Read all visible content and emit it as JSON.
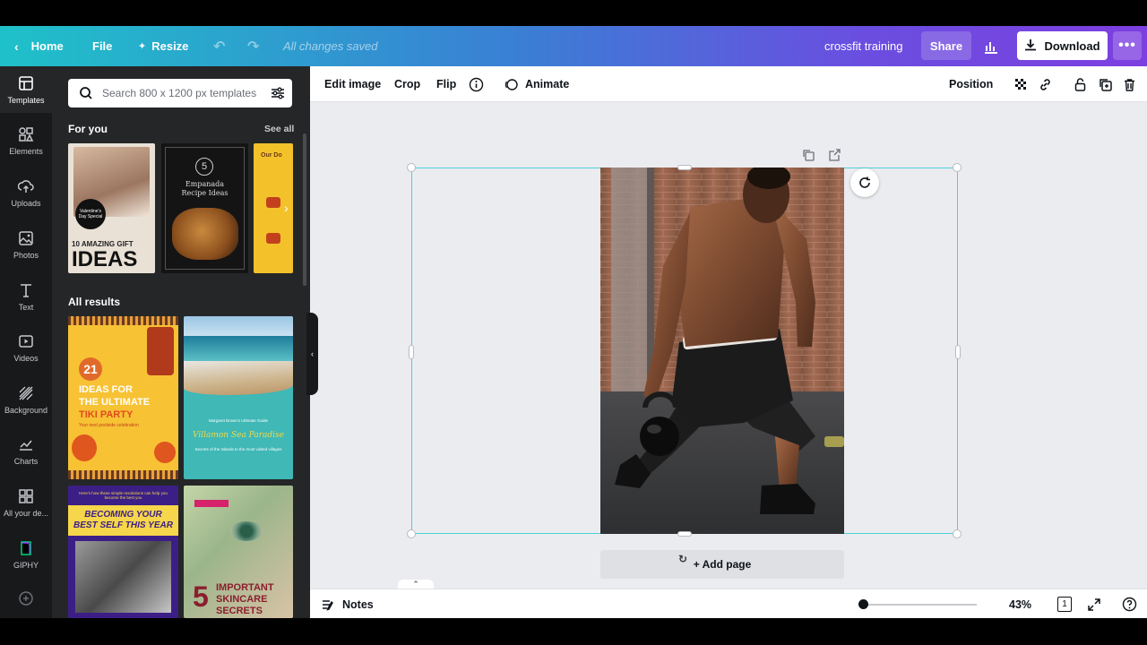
{
  "topbar": {
    "home_label": "Home",
    "file_label": "File",
    "resize_label": "Resize",
    "save_status": "All changes saved",
    "doc_title": "crossfit training",
    "share_label": "Share",
    "download_label": "Download",
    "more_label": "•••"
  },
  "rail": {
    "items": [
      {
        "label": "Templates",
        "icon": "templates-icon"
      },
      {
        "label": "Elements",
        "icon": "elements-icon"
      },
      {
        "label": "Uploads",
        "icon": "uploads-icon"
      },
      {
        "label": "Photos",
        "icon": "photos-icon"
      },
      {
        "label": "Text",
        "icon": "text-icon"
      },
      {
        "label": "Videos",
        "icon": "videos-icon"
      },
      {
        "label": "Background",
        "icon": "background-icon"
      },
      {
        "label": "Charts",
        "icon": "charts-icon"
      },
      {
        "label": "All your de...",
        "icon": "folder-icon"
      },
      {
        "label": "GIPHY",
        "icon": "giphy-icon"
      },
      {
        "label": "",
        "icon": "more-apps-icon"
      }
    ]
  },
  "panel": {
    "search_placeholder": "Search 800 x 1200 px templates",
    "for_you_title": "For you",
    "see_all_label": "See all",
    "all_results_title": "All results",
    "for_you_thumbs": [
      {
        "line1": "10 AMAZING GIFT",
        "line2": "IDEAS",
        "badge": "Valentine's Day Special"
      },
      {
        "number": "5",
        "line1": "Empanada",
        "line2": "Recipe Ideas"
      },
      {
        "line1": "Our Do"
      }
    ],
    "result_thumbs": [
      {
        "number": "21",
        "line1": "IDEAS FOR",
        "line2": "THE ULTIMATE",
        "line3": "TIKI PARTY",
        "line4": "Your next poolside celebration"
      },
      {
        "line1": "Margaret Brown's Ultimate Guide",
        "line2": "Villamon Sea Paradise",
        "line3": "Secrets of the Islands to the most visited villages"
      },
      {
        "line0": "Here's how these simple resolutions can help you become the best you",
        "line1": "BECOMING YOUR",
        "line2": "BEST SELF THIS YEAR"
      },
      {
        "number": "5",
        "line1": "IMPORTANT",
        "line2": "SKINCARE",
        "line3": "SECRETS"
      }
    ]
  },
  "toolbar": {
    "edit_image_label": "Edit image",
    "crop_label": "Crop",
    "flip_label": "Flip",
    "animate_label": "Animate",
    "position_label": "Position"
  },
  "canvas": {
    "add_page_label": "+ Add page"
  },
  "bottombar": {
    "notes_label": "Notes",
    "zoom_value": "43%",
    "page_count": "1"
  }
}
